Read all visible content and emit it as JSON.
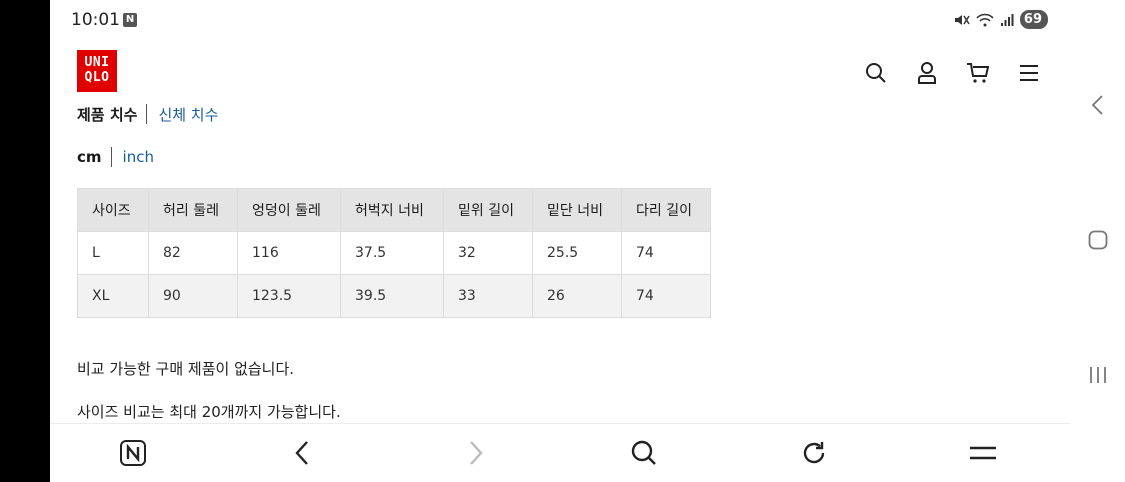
{
  "status_bar": {
    "time": "10:01",
    "notification_badge": "N",
    "battery": "69"
  },
  "header": {
    "logo_lines": [
      "UNI",
      "QLO"
    ],
    "icons": [
      "search-icon",
      "account-icon",
      "cart-icon",
      "menu-icon"
    ]
  },
  "size_tabs": {
    "active": "제품 치수",
    "inactive": "신체 치수"
  },
  "units": {
    "active": "cm",
    "inactive": "inch"
  },
  "size_table": {
    "headers": [
      "사이즈",
      "허리 둘레",
      "엉덩이 둘레",
      "허벅지 너비",
      "밑위 길이",
      "밑단 너비",
      "다리 길이"
    ],
    "rows": [
      [
        "L",
        "82",
        "116",
        "37.5",
        "32",
        "25.5",
        "74"
      ],
      [
        "XL",
        "90",
        "123.5",
        "39.5",
        "33",
        "26",
        "74"
      ]
    ]
  },
  "notes": {
    "no_compare": "비교 가능한 구매 제품이 없습니다.",
    "compare_limit": "사이즈 비교는 최대 20개까지 가능합니다."
  },
  "browser_bar": {
    "icons": [
      "naver-icon",
      "back-icon",
      "forward-icon",
      "search-icon",
      "reload-icon",
      "menu-icon"
    ]
  },
  "colors": {
    "brand_red": "#e00000",
    "link_blue": "#1a5a9c",
    "table_header_bg": "#e4e4e4"
  }
}
